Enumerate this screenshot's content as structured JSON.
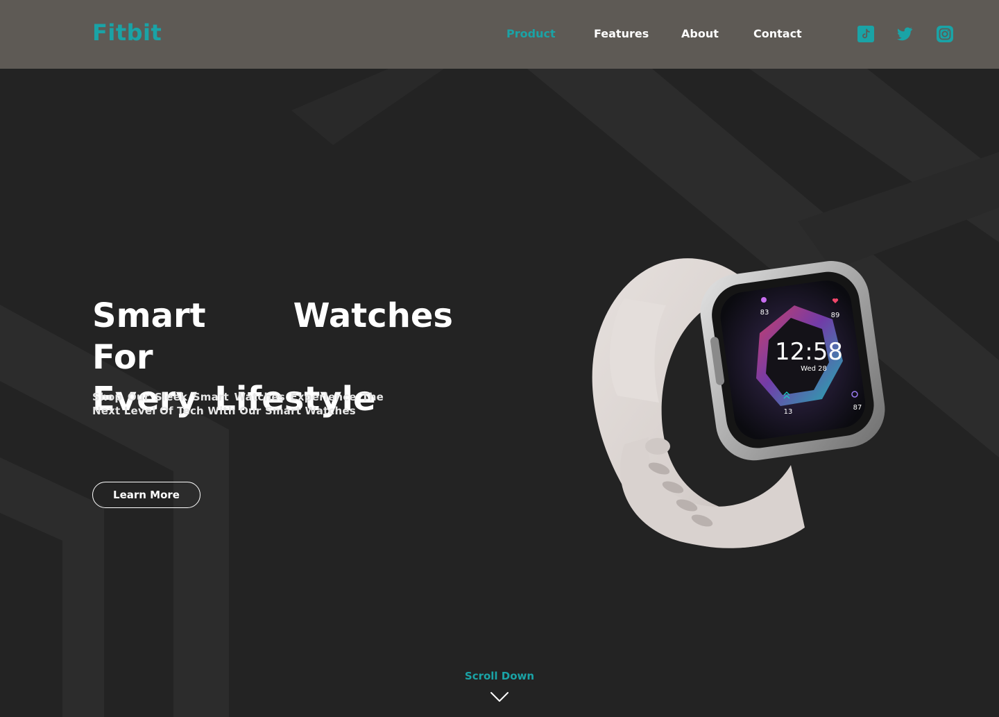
{
  "brand": {
    "name": "Fitbit"
  },
  "nav": {
    "items": [
      {
        "label": "Product",
        "active": true
      },
      {
        "label": "Features",
        "active": false
      },
      {
        "label": "About",
        "active": false
      },
      {
        "label": "Contact",
        "active": false
      }
    ],
    "social": [
      "tiktok-icon",
      "twitter-icon",
      "instagram-icon"
    ]
  },
  "hero": {
    "title_line1": "Smart Watches For",
    "title_line2": "Every Lifestyle",
    "subtitle": "Shop Our Sleek Smart Watches Experience The Next Level Of Tech With Our Smart Watches",
    "cta_label": "Learn More"
  },
  "watch_face": {
    "time": "12:58",
    "date": "Wed 28",
    "stats": {
      "top_left": "83",
      "top_right": "89",
      "bottom_left": "13",
      "bottom_right": "87"
    }
  },
  "scroll": {
    "label": "Scroll Down"
  },
  "colors": {
    "accent": "#1aa3a6",
    "nav_bg": "#5e5a55",
    "hero_bg": "#232323",
    "text": "#ffffff"
  }
}
